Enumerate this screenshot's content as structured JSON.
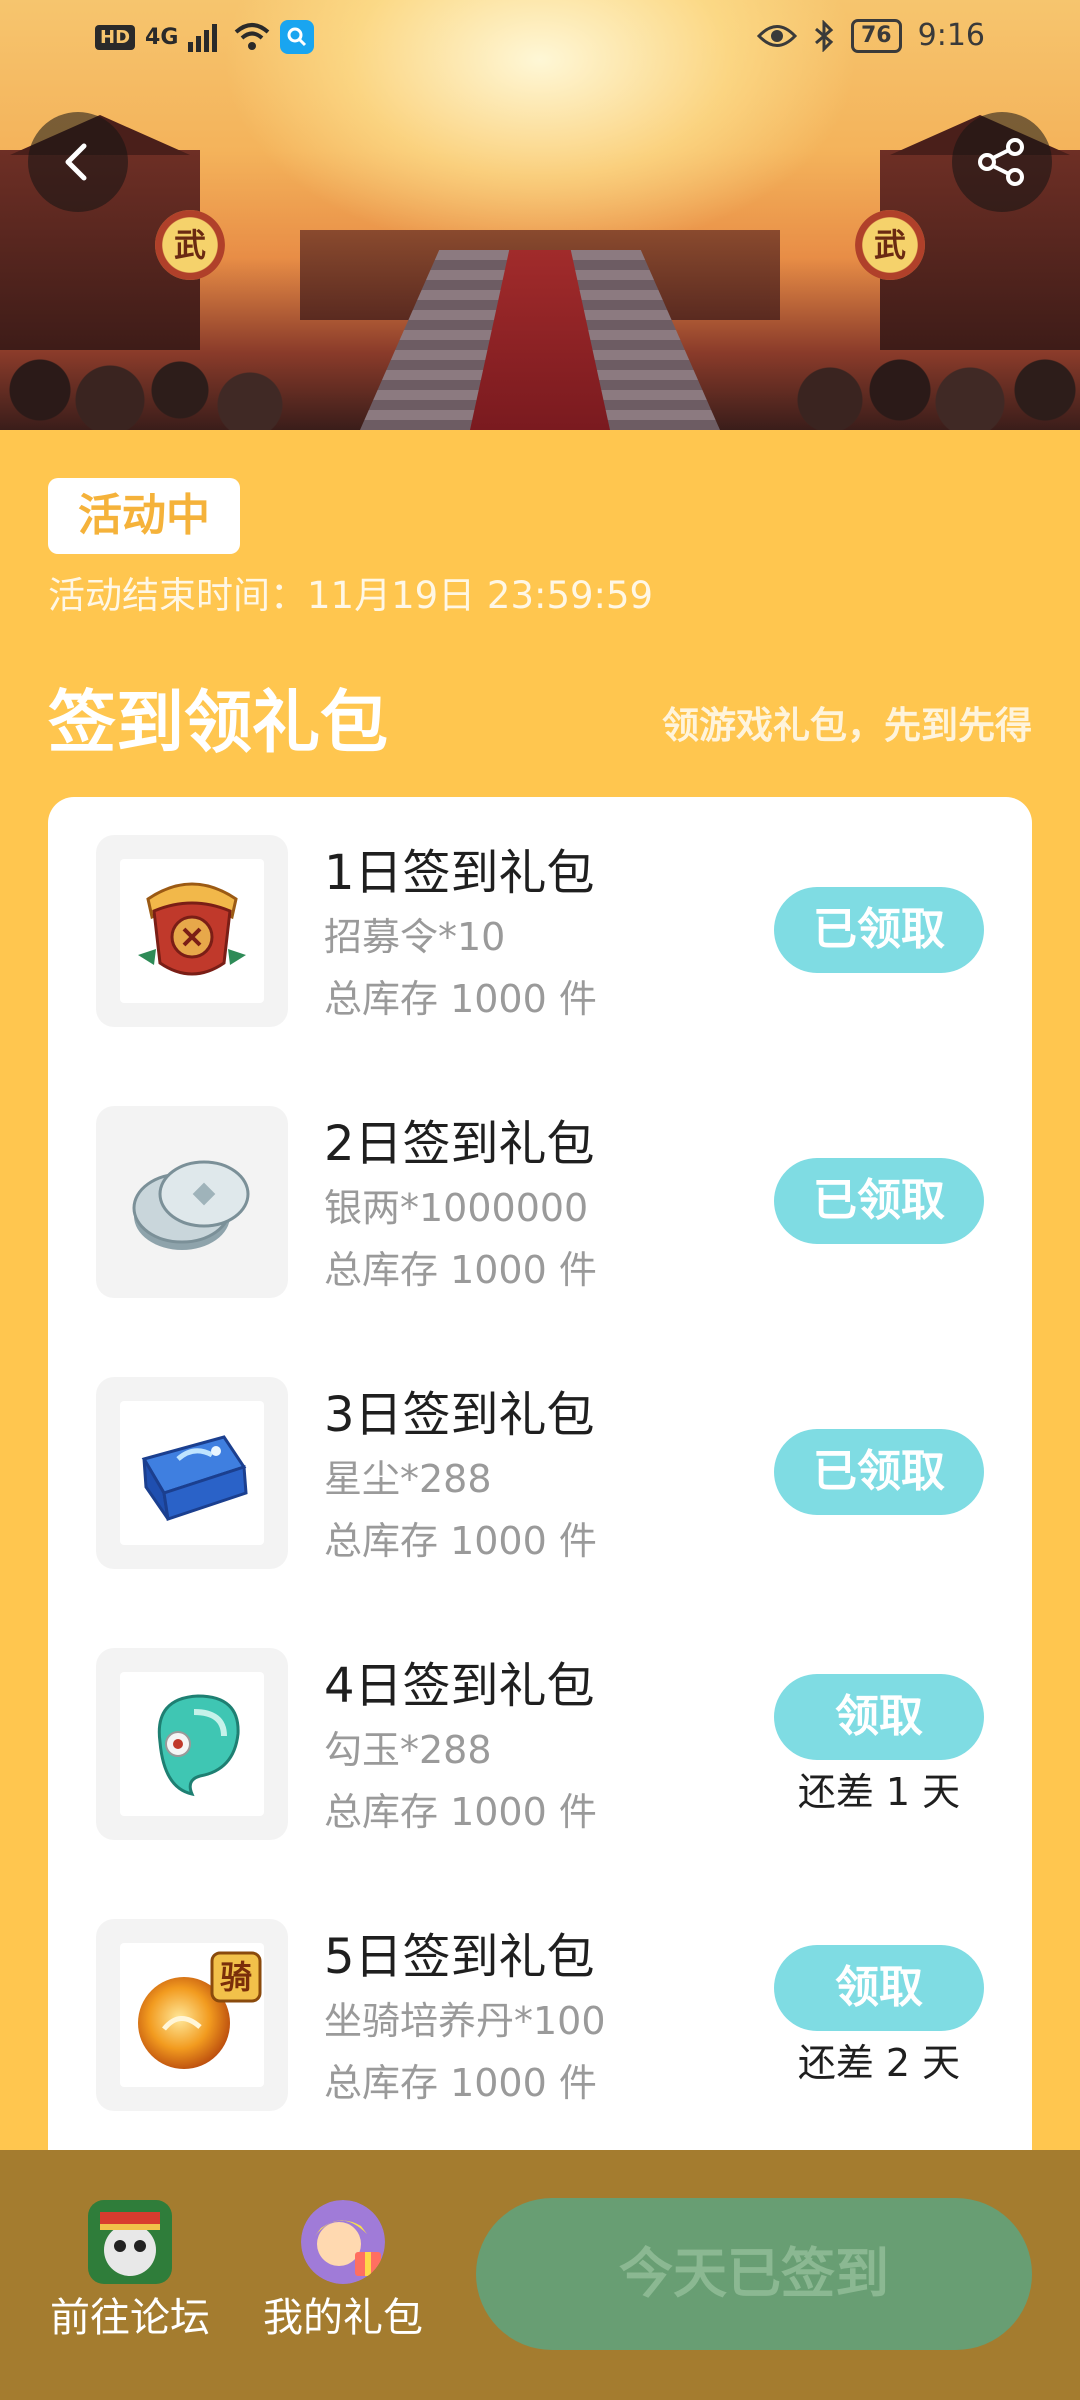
{
  "status_bar": {
    "hd_label": "HD",
    "network_label": "4G",
    "battery_level": "76",
    "time": "9:16"
  },
  "hero": {
    "banner_left_char": "武",
    "banner_right_char": "武"
  },
  "activity": {
    "status": "活动中",
    "end_time": "活动结束时间：11月19日 23:59:59"
  },
  "section": {
    "title": "签到领礼包",
    "subtitle": "领游戏礼包，先到先得"
  },
  "gifts": [
    {
      "name": "1日签到礼包",
      "item": "招募令*10",
      "stock": "总库存 1000 件",
      "button": "已领取",
      "note": "",
      "icon": "recruit-token-icon"
    },
    {
      "name": "2日签到礼包",
      "item": "银两*1000000",
      "stock": "总库存 1000 件",
      "button": "已领取",
      "note": "",
      "icon": "silver-coin-icon"
    },
    {
      "name": "3日签到礼包",
      "item": "星尘*288",
      "stock": "总库存 1000 件",
      "button": "已领取",
      "note": "",
      "icon": "stardust-chest-icon"
    },
    {
      "name": "4日签到礼包",
      "item": "勾玉*288",
      "stock": "总库存 1000 件",
      "button": "领取",
      "note": "还差 1 天",
      "icon": "magatama-icon"
    },
    {
      "name": "5日签到礼包",
      "item": "坐骑培养丹*100",
      "stock": "总库存 1000 件",
      "button": "领取",
      "note": "还差 2 天",
      "icon": "mount-pill-icon"
    }
  ],
  "bottom_bar": {
    "forum_label": "前往论坛",
    "gifts_label": "我的礼包",
    "signin_label": "今天已签到",
    "mount_badge": "骑"
  },
  "colors": {
    "page_background": "#FFC64F",
    "button_teal": "#7FDCE3",
    "bottom_bar": "#A47C2F",
    "signin_button": "#689E73"
  }
}
